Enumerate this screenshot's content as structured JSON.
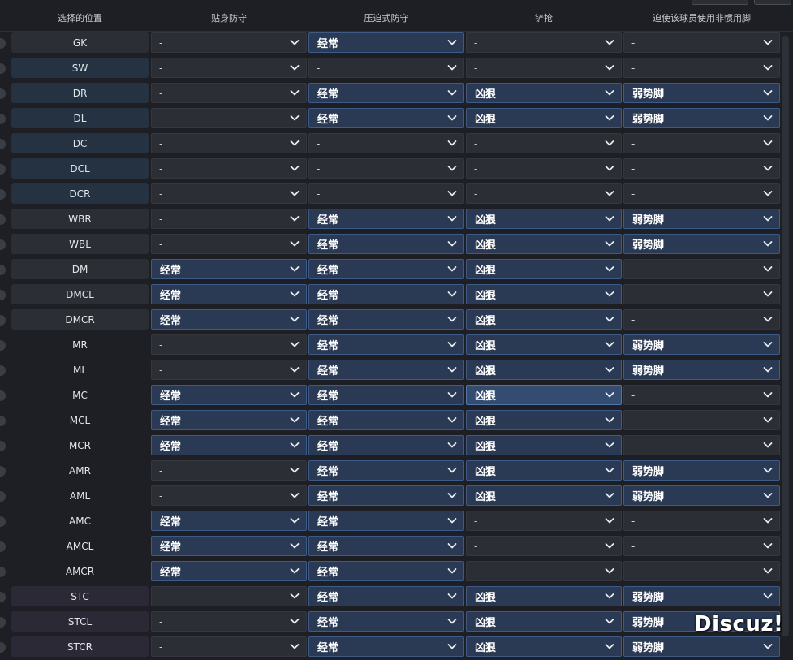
{
  "header": {
    "col0": "选择的位置",
    "col1": "贴身防守",
    "col2": "压迫式防守",
    "col3": "铲抢",
    "col4": "迫使该球员使用非惯用脚"
  },
  "rows": [
    {
      "pos": "GK",
      "style": "gray",
      "c": [
        "-",
        "经常",
        "-",
        "-"
      ]
    },
    {
      "pos": "SW",
      "style": "blue",
      "c": [
        "-",
        "-",
        "-",
        "-"
      ]
    },
    {
      "pos": "DR",
      "style": "blue",
      "c": [
        "-",
        "经常",
        "凶狠",
        "弱势脚"
      ]
    },
    {
      "pos": "DL",
      "style": "blue",
      "c": [
        "-",
        "经常",
        "凶狠",
        "弱势脚"
      ]
    },
    {
      "pos": "DC",
      "style": "blue",
      "c": [
        "-",
        "-",
        "-",
        "-"
      ]
    },
    {
      "pos": "DCL",
      "style": "blue",
      "c": [
        "-",
        "-",
        "-",
        "-"
      ]
    },
    {
      "pos": "DCR",
      "style": "blue",
      "c": [
        "-",
        "-",
        "-",
        "-"
      ]
    },
    {
      "pos": "WBR",
      "style": "gray",
      "c": [
        "-",
        "经常",
        "凶狠",
        "弱势脚"
      ]
    },
    {
      "pos": "WBL",
      "style": "gray",
      "c": [
        "-",
        "经常",
        "凶狠",
        "弱势脚"
      ]
    },
    {
      "pos": "DM",
      "style": "gray",
      "c": [
        "经常",
        "经常",
        "凶狠",
        "-"
      ]
    },
    {
      "pos": "DMCL",
      "style": "gray",
      "c": [
        "经常",
        "经常",
        "凶狠",
        "-"
      ]
    },
    {
      "pos": "DMCR",
      "style": "gray",
      "c": [
        "经常",
        "经常",
        "凶狠",
        "-"
      ]
    },
    {
      "pos": "MR",
      "style": "plain",
      "c": [
        "-",
        "经常",
        "凶狠",
        "弱势脚"
      ]
    },
    {
      "pos": "ML",
      "style": "plain",
      "c": [
        "-",
        "经常",
        "凶狠",
        "弱势脚"
      ]
    },
    {
      "pos": "MC",
      "style": "plain",
      "c": [
        "经常",
        "经常",
        "凶狠",
        "-"
      ]
    },
    {
      "pos": "MCL",
      "style": "plain",
      "c": [
        "经常",
        "经常",
        "凶狠",
        "-"
      ]
    },
    {
      "pos": "MCR",
      "style": "plain",
      "c": [
        "经常",
        "经常",
        "凶狠",
        "-"
      ]
    },
    {
      "pos": "AMR",
      "style": "plain",
      "c": [
        "-",
        "经常",
        "凶狠",
        "弱势脚"
      ]
    },
    {
      "pos": "AML",
      "style": "plain",
      "c": [
        "-",
        "经常",
        "凶狠",
        "弱势脚"
      ]
    },
    {
      "pos": "AMC",
      "style": "plain",
      "c": [
        "经常",
        "经常",
        "-",
        "-"
      ]
    },
    {
      "pos": "AMCL",
      "style": "plain",
      "c": [
        "经常",
        "经常",
        "-",
        "-"
      ]
    },
    {
      "pos": "AMCR",
      "style": "plain",
      "c": [
        "经常",
        "经常",
        "-",
        "-"
      ]
    },
    {
      "pos": "STC",
      "style": "purple",
      "c": [
        "-",
        "经常",
        "凶狠",
        "弱势脚"
      ]
    },
    {
      "pos": "STCL",
      "style": "purple",
      "c": [
        "-",
        "经常",
        "凶狠",
        "弱势脚"
      ]
    },
    {
      "pos": "STCR",
      "style": "purple",
      "c": [
        "-",
        "经常",
        "凶狠",
        "弱势脚"
      ]
    }
  ],
  "highlighted": {
    "row": 14,
    "col": 2
  },
  "watermark": "Discuz!",
  "icons": {
    "dropdown": "chevron-down-icon",
    "row_check": "check-circle-icon"
  },
  "colors": {
    "background": "#1d1f24",
    "selected_cell": "#2a3a55",
    "selected_border": "#3e5a86",
    "position_blue": "#243241"
  }
}
